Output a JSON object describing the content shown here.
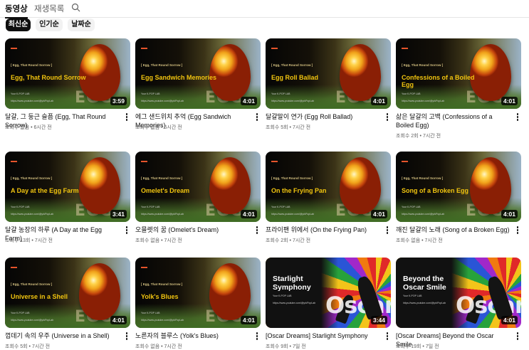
{
  "tabs": [
    "동영상",
    "재생목록"
  ],
  "chips": [
    "최신순",
    "인기순",
    "날짜순"
  ],
  "videos": [
    {
      "title": "달걀, 그 둥근 슬픔 (Egg, That Round Sorrow)",
      "meta": "조회수 없음 • 6시간 전",
      "duration": "3:59",
      "thumb_title": "Egg, That Round Sorrow",
      "thumb_type": "egg"
    },
    {
      "title": "에그 샌드위치 추억 (Egg Sandwich Memories)",
      "meta": "조회수 없음 • 6시간 전",
      "duration": "4:01",
      "thumb_title": "Egg Sandwich Memories",
      "thumb_type": "egg"
    },
    {
      "title": "달걀말이 연가 (Egg Roll Ballad)",
      "meta": "조회수 5회 • 7시간 전",
      "duration": "4:01",
      "thumb_title": "Egg Roll Ballad",
      "thumb_type": "egg"
    },
    {
      "title": "삶은 달걀의 고백 (Confessions of a Boiled Egg)",
      "meta": "조회수 2회 • 7시간 전",
      "duration": "4:01",
      "thumb_title": "Confessions of a Boiled Egg",
      "thumb_type": "egg"
    },
    {
      "title": "달걀 농장의 하루 (A Day at the Egg Farm)",
      "meta": "조회수 13회 • 7시간 전",
      "duration": "3:41",
      "thumb_title": "A Day at the Egg Farm",
      "thumb_type": "egg"
    },
    {
      "title": "오믈렛의 꿈 (Omelet's Dream)",
      "meta": "조회수 없음 • 7시간 전",
      "duration": "4:01",
      "thumb_title": "Omelet's Dream",
      "thumb_type": "egg"
    },
    {
      "title": "프라이팬 위에서 (On the Frying Pan)",
      "meta": "조회수 2회 • 7시간 전",
      "duration": "4:01",
      "thumb_title": "On the Frying Pan",
      "thumb_type": "egg"
    },
    {
      "title": "깨진 달걀의 노래 (Song of a Broken Egg)",
      "meta": "조회수 없음 • 7시간 전",
      "duration": "4:01",
      "thumb_title": "Song of a Broken Egg",
      "thumb_type": "egg"
    },
    {
      "title": "껍데기 속의 우주 (Universe in a Shell)",
      "meta": "조회수 5회 • 7시간 전",
      "duration": "4:01",
      "thumb_title": "Universe in a Shell",
      "thumb_type": "egg"
    },
    {
      "title": "노른자의 블루스 (Yolk's Blues)",
      "meta": "조회수 없음 • 7시간 전",
      "duration": "4:01",
      "thumb_title": "Yolk's Blues",
      "thumb_type": "egg"
    },
    {
      "title": "[Oscar Dreams] Starlight Symphony",
      "meta": "조회수 9회 • 7일 전",
      "duration": "3:44",
      "thumb_title": "Starlight Symphony",
      "thumb_type": "oscar"
    },
    {
      "title": "[Oscar Dreams] Beyond the Oscar Smile",
      "meta": "조회수 19회 • 7일 전",
      "duration": "4:01",
      "thumb_title": "Beyond the Oscar Smile",
      "thumb_type": "oscar"
    }
  ],
  "thumb_texts": {
    "egg_series": "[ Egg, That Round Sorrow ]",
    "egg_word": "EGG",
    "oscar_word": "Oscar",
    "artist": "Your K-POP LAB",
    "url": "https://www.youtube.com/@yrkPopLab"
  },
  "colors": {
    "accent_bar": "#e5542b",
    "thumb_title": "#f1c40f",
    "selected_chip": "#0f0f0f"
  }
}
